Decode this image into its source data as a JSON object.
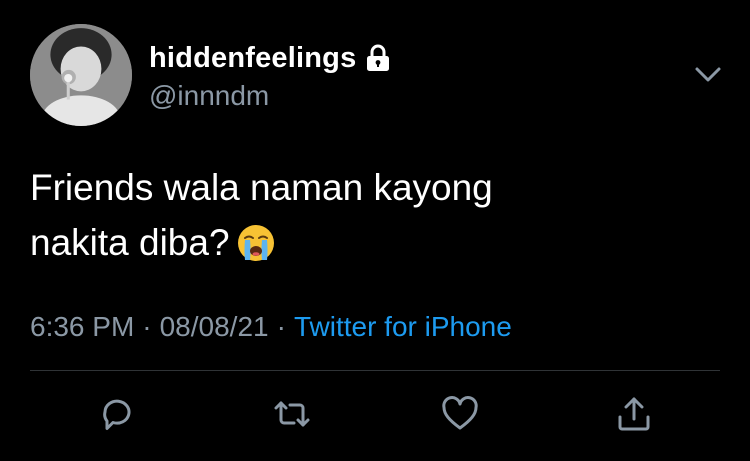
{
  "user": {
    "display_name": "hiddenfeelings",
    "handle": "@innndm",
    "protected_icon": "lock-icon",
    "avatar": "avatar-photo"
  },
  "tweet": {
    "text_lines": [
      "Friends wala naman kayong",
      "nakita diba?"
    ],
    "emoji": "loudly-crying-face-emoji"
  },
  "meta": {
    "time": "6:36 PM",
    "separator": "·",
    "date": "08/08/21",
    "source": "Twitter for iPhone"
  },
  "actions": {
    "reply": "reply-icon",
    "retweet": "retweet-icon",
    "like": "heart-icon",
    "share": "share-icon"
  },
  "menu": {
    "more": "chevron-down-icon"
  },
  "colors": {
    "background": "#000000",
    "text": "#ffffff",
    "secondary_text": "#8b98a5",
    "link": "#1d9bf0",
    "divider": "#2f3336",
    "icon": "#8b98a5"
  }
}
